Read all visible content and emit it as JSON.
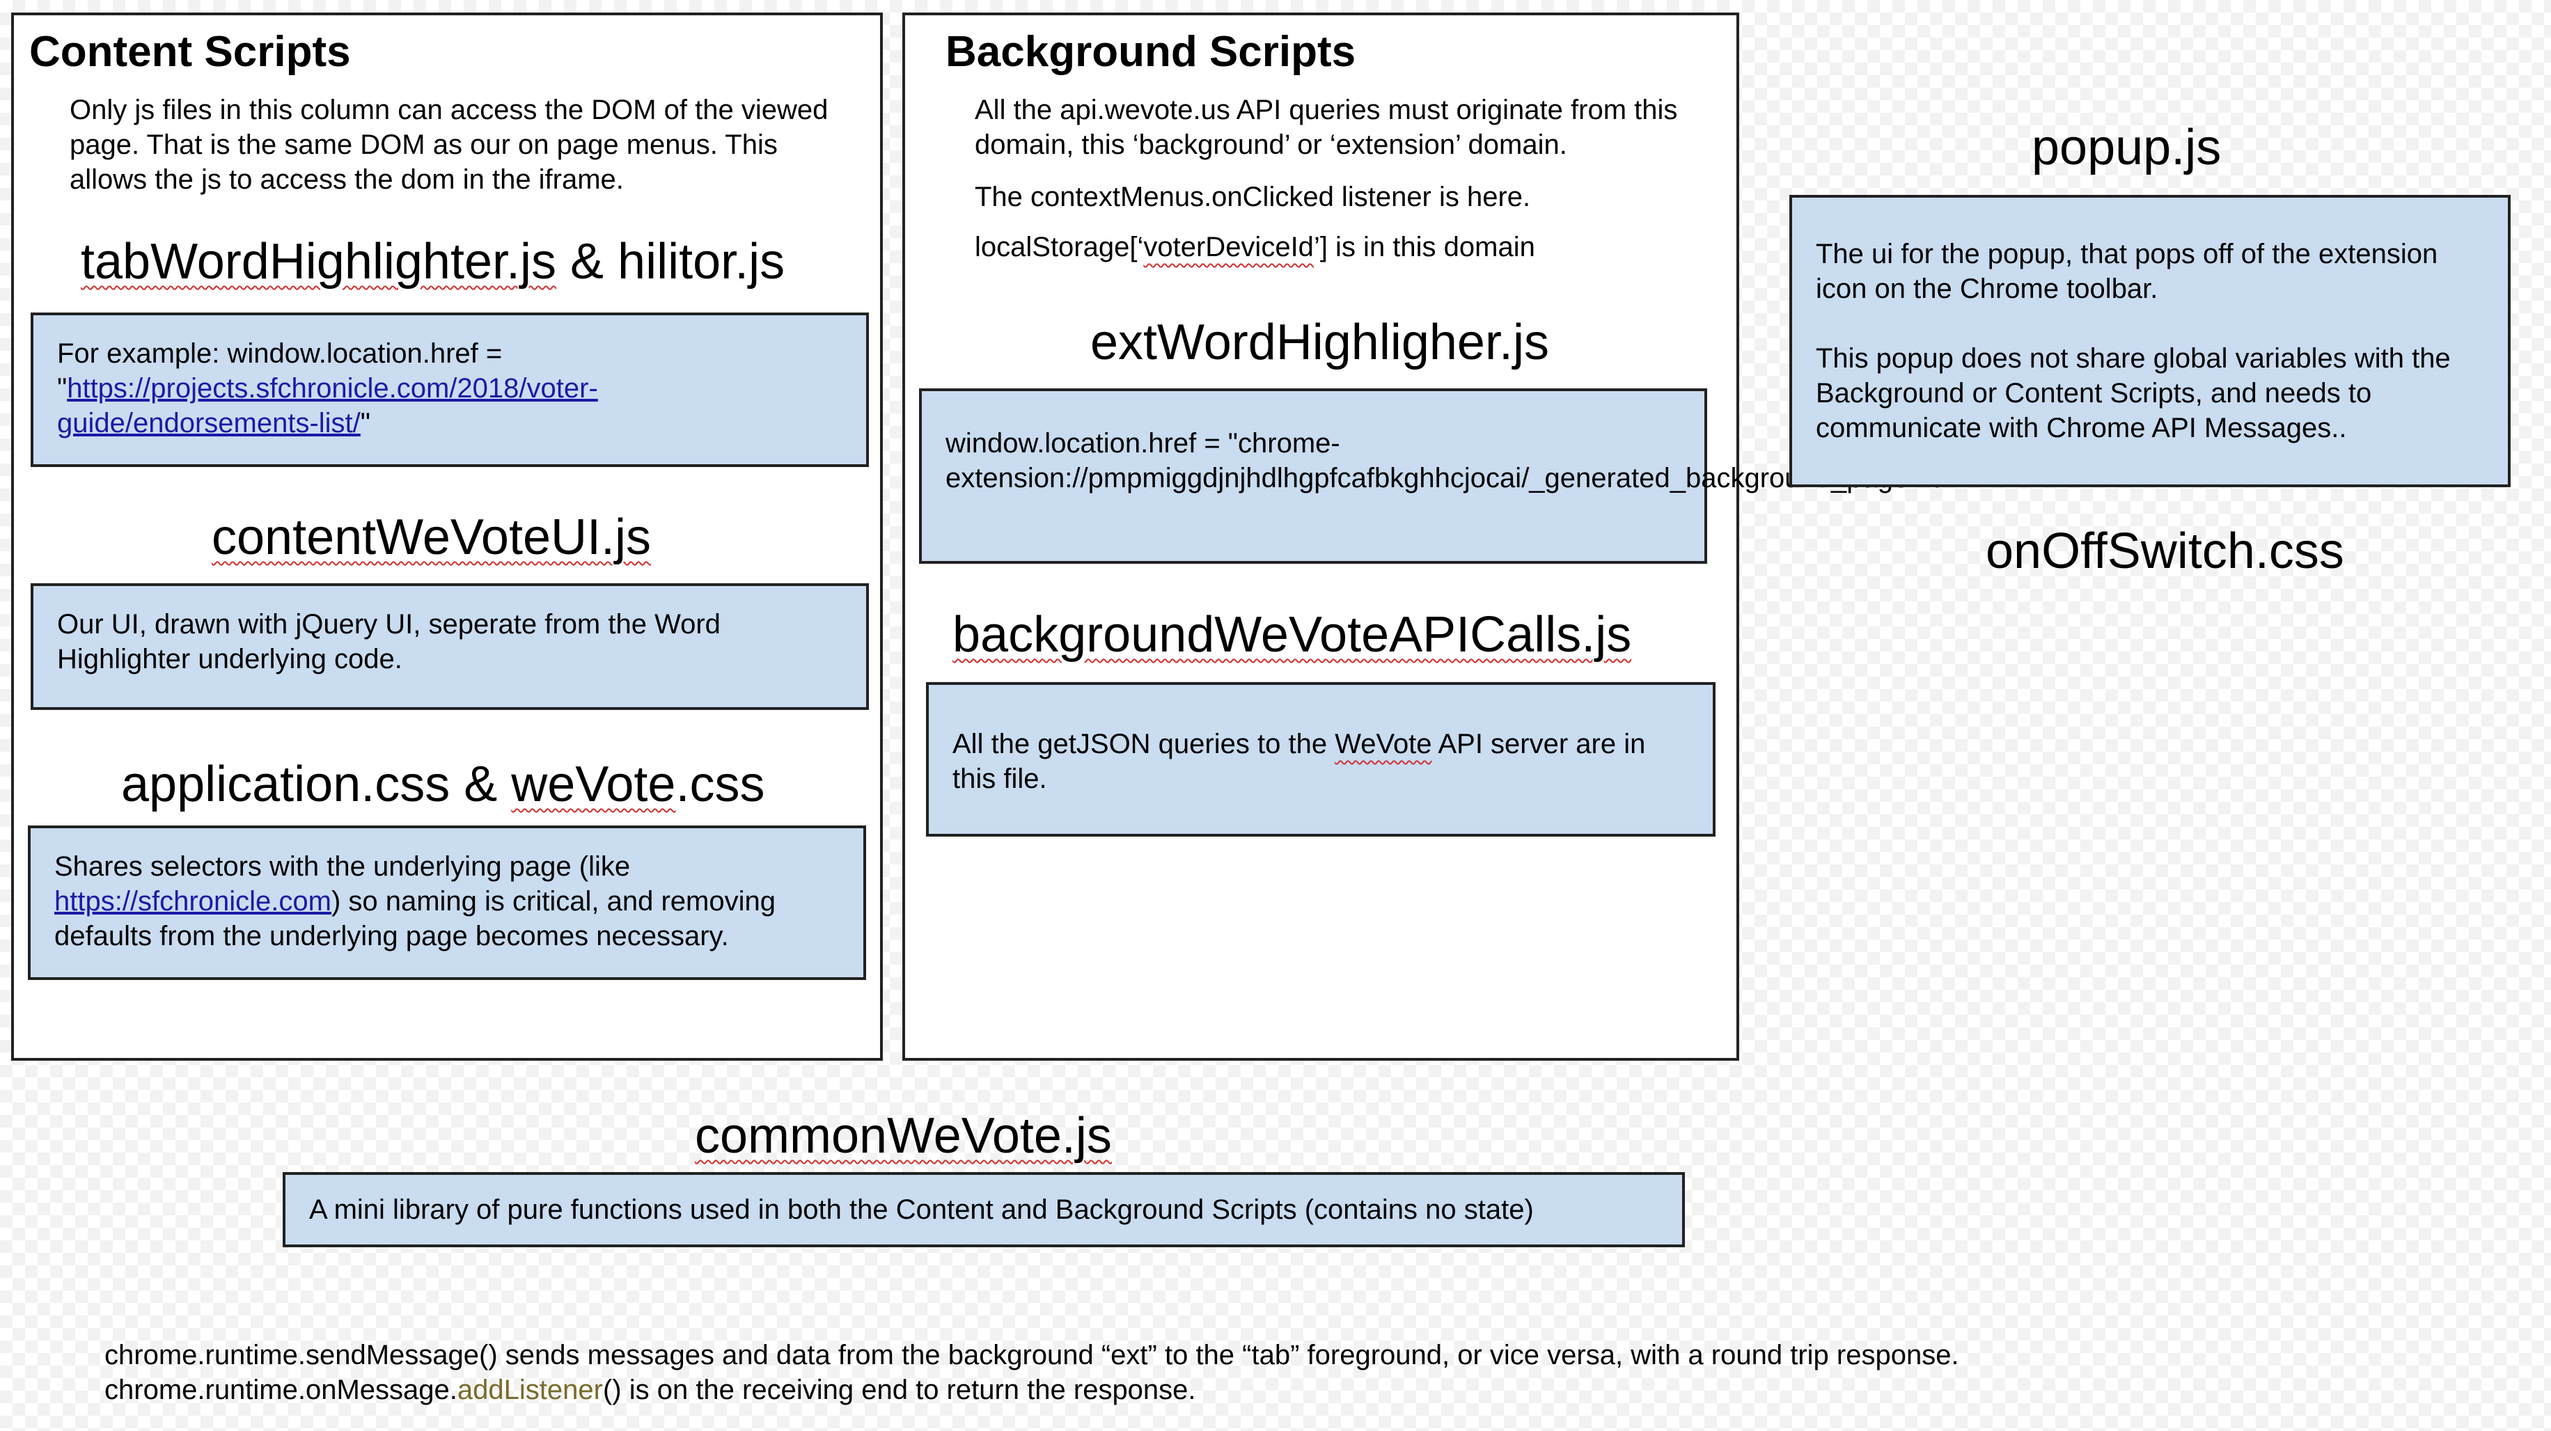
{
  "content_scripts": {
    "title": "Content Scripts",
    "intro": "Only js files in this column can access the DOM of the viewed page.  That is the same DOM as our on page menus.  This allows the js to access the dom in the iframe.",
    "tab_highlighter": {
      "name_a": "tabWordHighlighter.js",
      "name_b": " & hilitor.js",
      "prefix": "For example:  window.location.href = \"",
      "link": "https://projects.sfchronicle.com/2018/voter-guide/endorsements-list/",
      "suffix": "\""
    },
    "content_ui": {
      "name": "contentWeVoteUI.js",
      "text": "Our UI, drawn with jQuery UI, seperate from the Word Highlighter underlying code."
    },
    "css": {
      "name_a": "application.css & ",
      "name_b": "weVote",
      "name_c": ".css",
      "prefix": "Shares selectors with the underlying page (like ",
      "link": "https://sfchronicle.com",
      "suffix": ") so naming is critical, and removing defaults from the underlying page becomes necessary."
    }
  },
  "background_scripts": {
    "title": "Background Scripts",
    "note1": "All the api.wevote.us API queries must originate from this domain, this ‘background’ or ‘extension’ domain.",
    "note2": "The contextMenus.onClicked listener is here.",
    "note3_a": "localStorage[‘",
    "note3_b": "voterDeviceId",
    "note3_c": "’] is in this domain",
    "ext_highlighter": {
      "name": "extWordHighligher.js",
      "text": "window.location.href = \"chrome-extension://pmpmiggdjnjhdlhgpfcafbkghhcjocai/_generated_background_page.html\""
    },
    "api_calls": {
      "name": "backgroundWeVoteAPICalls.js",
      "text_a": "All the getJSON queries to the ",
      "text_b": "WeVote",
      "text_c": " API server are in this file."
    }
  },
  "popup": {
    "name": "popup.js",
    "text1": "The ui for the popup, that pops off of the extension icon on the Chrome toolbar.",
    "text2": "This popup does not share global variables with the Background or Content Scripts, and needs to communicate with Chrome API Messages..",
    "switch_css": "onOffSwitch.css"
  },
  "common": {
    "name": "commonWeVote.js",
    "text": "A mini library of pure functions used in both the Content and Background Scripts (contains no state)"
  },
  "footer": {
    "line1": "chrome.runtime.sendMessage() sends messages and data from the background “ext” to the “tab” foreground, or vice versa, with a round trip response.",
    "line2_a": "chrome.runtime.onMessage.",
    "line2_b": "addListener",
    "line2_c": "() is on the receiving end to return the response."
  }
}
